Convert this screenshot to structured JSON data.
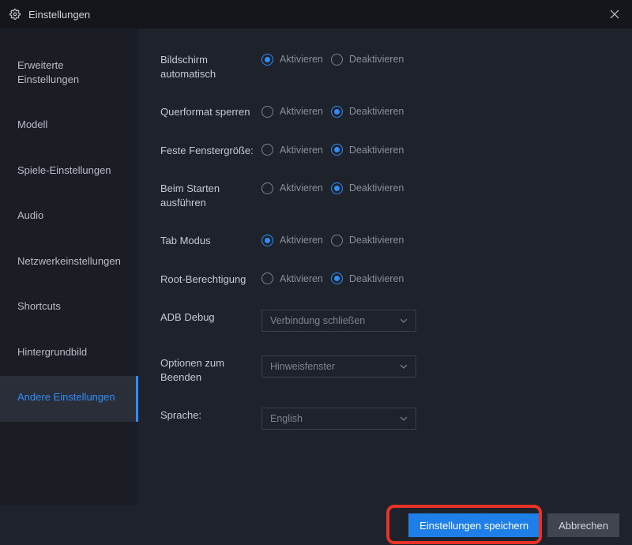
{
  "window": {
    "title": "Einstellungen"
  },
  "sidebar": {
    "items": [
      {
        "label": "Erweiterte Einstellungen"
      },
      {
        "label": "Modell"
      },
      {
        "label": "Spiele-Einstellungen"
      },
      {
        "label": "Audio"
      },
      {
        "label": "Netzwerkeinstellungen"
      },
      {
        "label": "Shortcuts"
      },
      {
        "label": "Hintergrundbild"
      },
      {
        "label": "Andere Einstellungen"
      }
    ],
    "active_index": 7
  },
  "radio": {
    "activate": "Aktivieren",
    "deactivate": "Deaktivieren"
  },
  "settings": {
    "items": [
      {
        "label": "Bildschirm automatisch",
        "type": "radio",
        "selected": "activate"
      },
      {
        "label": "Querformat sperren",
        "type": "radio",
        "selected": "deactivate"
      },
      {
        "label": "Feste Fenstergröße:",
        "type": "radio",
        "selected": "deactivate"
      },
      {
        "label": "Beim Starten ausführen",
        "type": "radio",
        "selected": "deactivate"
      },
      {
        "label": "Tab Modus",
        "type": "radio",
        "selected": "activate"
      },
      {
        "label": "Root-Berechtigung",
        "type": "radio",
        "selected": "deactivate"
      },
      {
        "label": "ADB Debug",
        "type": "dropdown",
        "value": "Verbindung schließen"
      },
      {
        "label": "Optionen zum Beenden",
        "type": "dropdown",
        "value": "Hinweisfenster"
      },
      {
        "label": "Sprache:",
        "type": "dropdown",
        "value": "English"
      }
    ]
  },
  "footer": {
    "save": "Einstellungen speichern",
    "cancel": "Abbrechen"
  }
}
